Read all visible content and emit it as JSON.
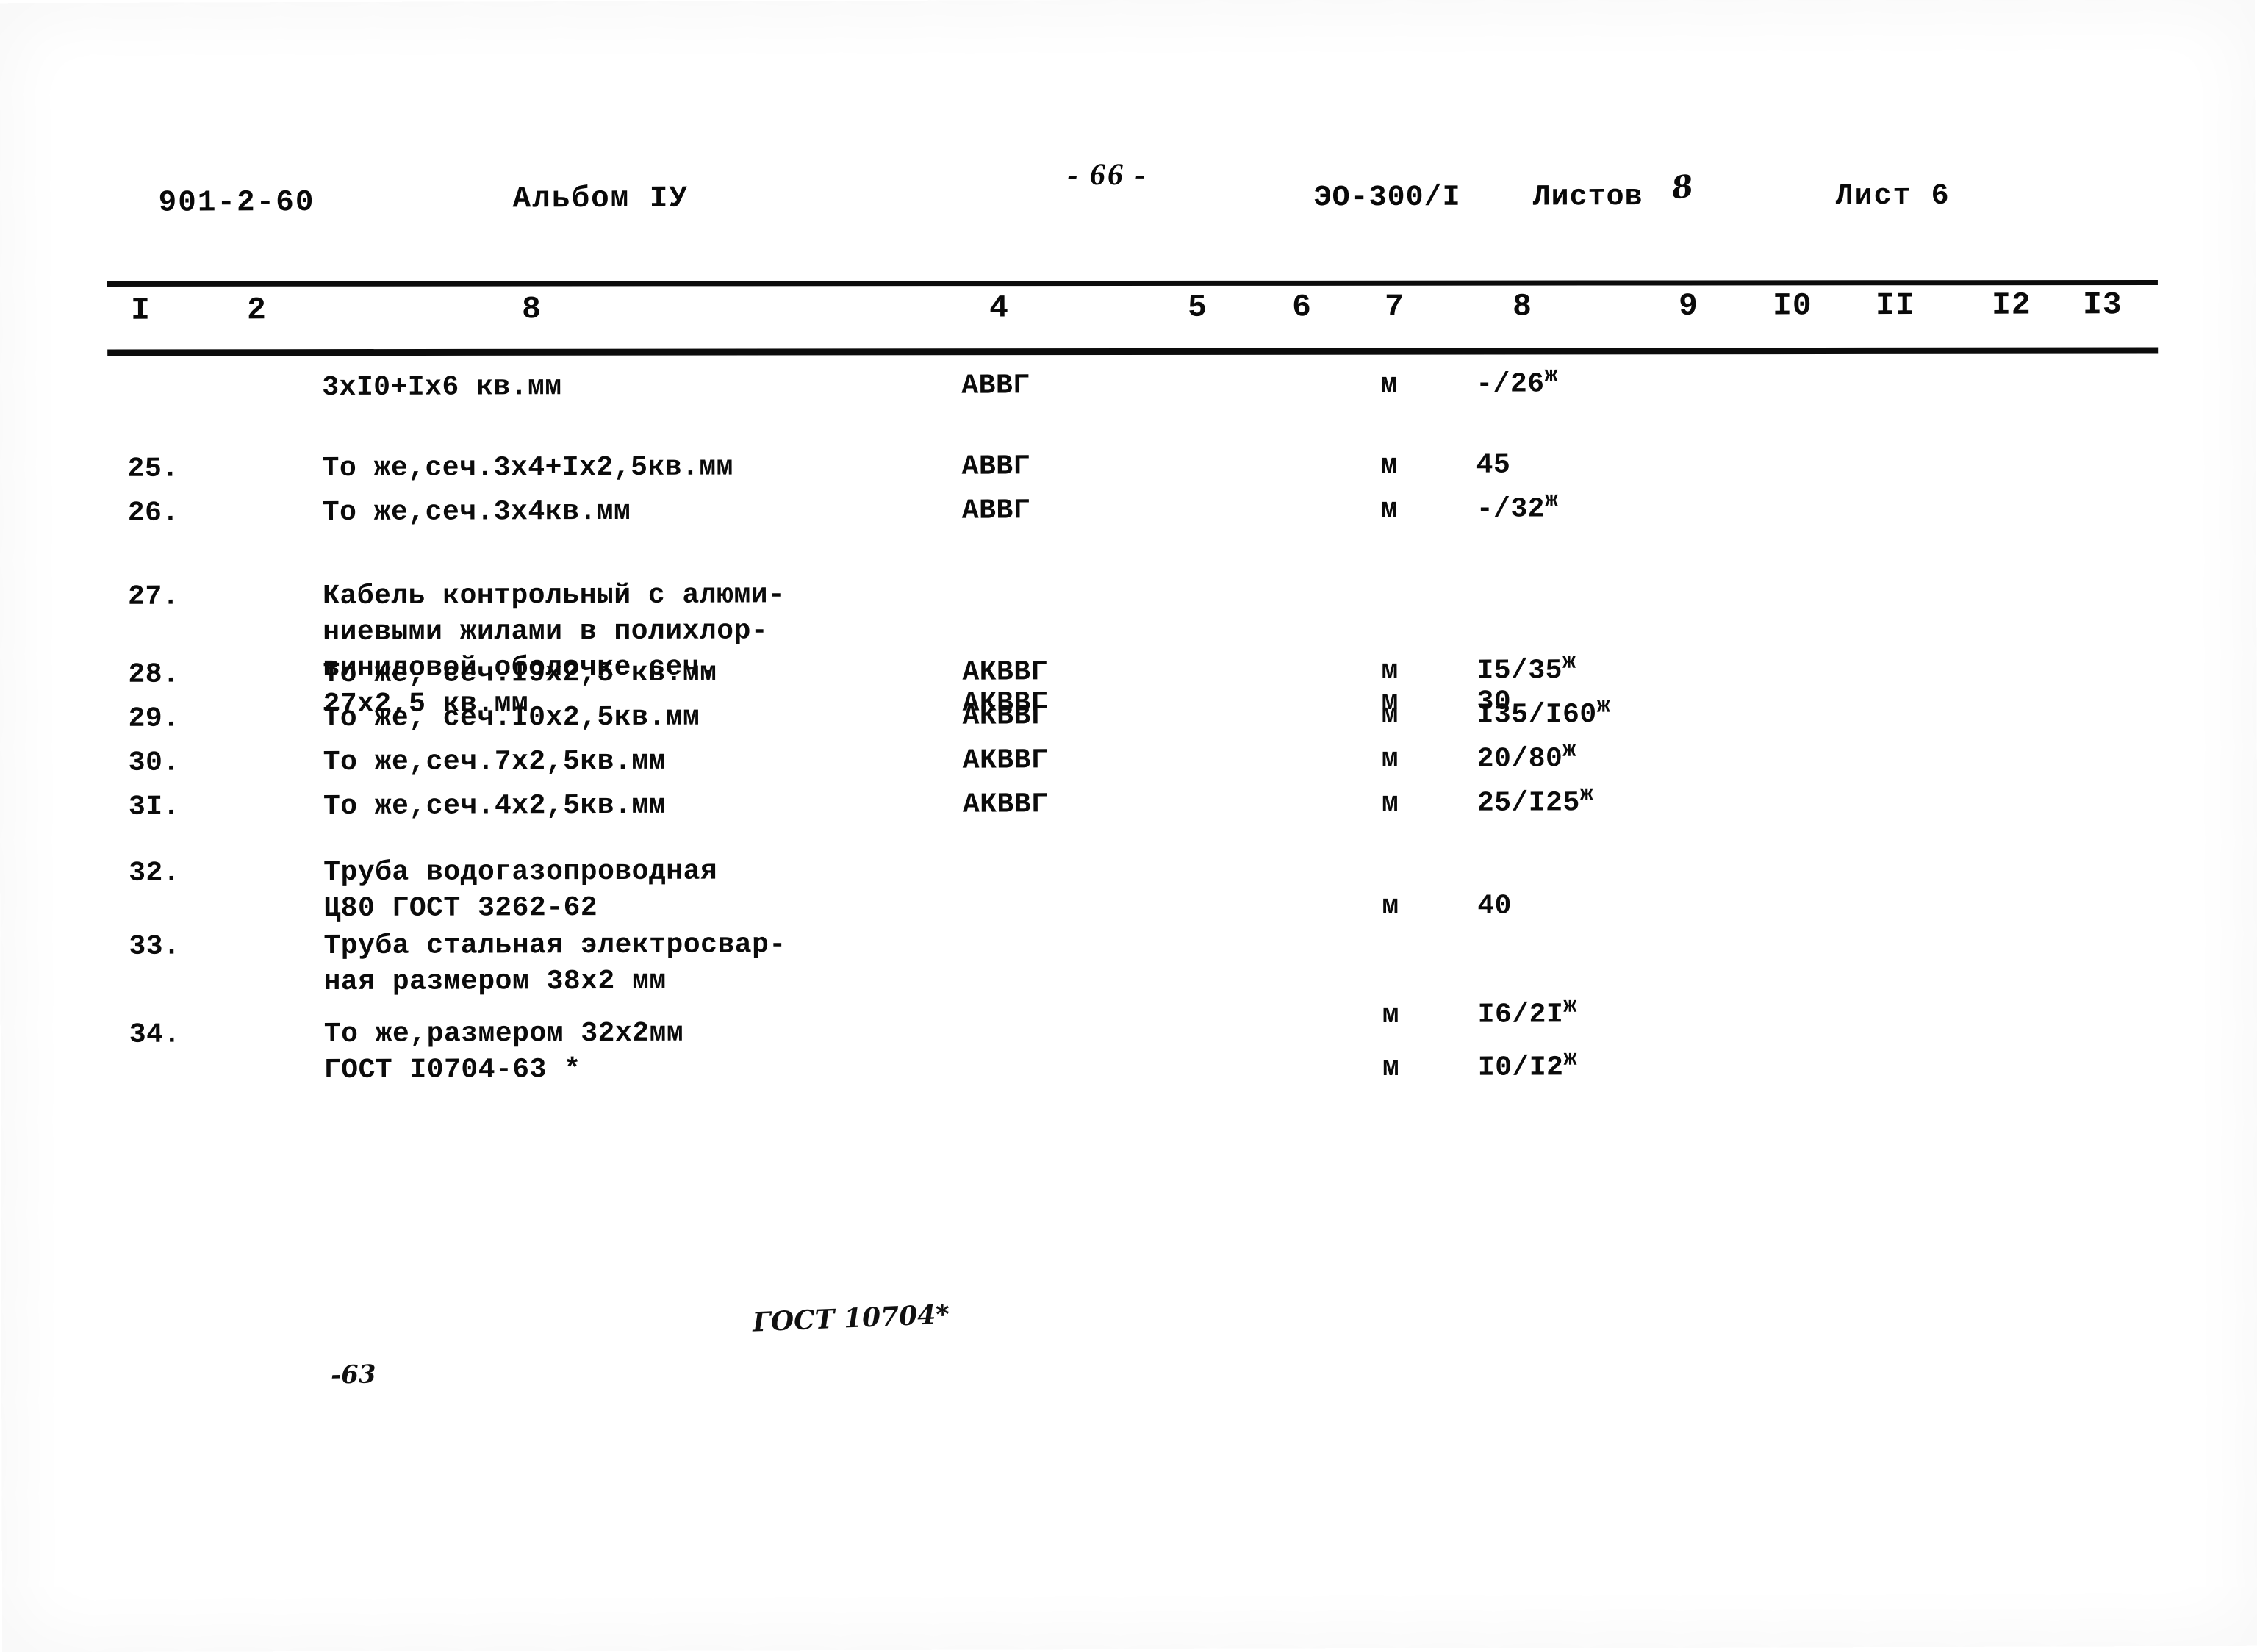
{
  "header": {
    "doc_code": "901-2-60",
    "album": "Альбом IУ",
    "page_number": "- 66 -",
    "sheet_id": "ЭО-300/I",
    "listov_label": "Листов",
    "listov_value": "8",
    "list_label": "Лист 6"
  },
  "table": {
    "column_numbers": [
      "I",
      "2",
      "8",
      "4",
      "5",
      "6",
      "7",
      "8",
      "9",
      "I0",
      "II",
      "I2",
      "I3"
    ],
    "rows": [
      {
        "num": "",
        "desc": [
          "3хI0+Iх6 кв.мм"
        ],
        "brand": "АВВГ",
        "unit": "м",
        "qty": "-/26",
        "qty_sup": "ж"
      },
      {
        "num": "25.",
        "desc": [
          "То же,сеч.3х4+Iх2,5кв.мм"
        ],
        "brand": "АВВГ",
        "unit": "м",
        "qty": "45",
        "qty_sup": ""
      },
      {
        "num": "26.",
        "desc": [
          "То же,сеч.3х4кв.мм"
        ],
        "brand": "АВВГ",
        "unit": "м",
        "qty": "-/32",
        "qty_sup": "ж"
      },
      {
        "num": "27.",
        "desc": [
          "Кабель контрольный с алюми-",
          "ниевыми жилами в полихлор-",
          "виниловой оболочке сеч.",
          "27х2,5 кв.мм"
        ],
        "brand": "АКВВГ",
        "unit": "м",
        "qty": "30",
        "qty_sup": ""
      },
      {
        "num": "28.",
        "desc": [
          "То же, сеч.I9х2,5 кв.мм"
        ],
        "brand": "АКВВГ",
        "unit": "м",
        "qty": "I5/35",
        "qty_sup": "ж"
      },
      {
        "num": "29.",
        "desc": [
          "То же, сеч.I0х2,5кв.мм"
        ],
        "brand": "АКВВГ",
        "unit": "м",
        "qty": "I35/I60",
        "qty_sup": "ж"
      },
      {
        "num": "30.",
        "desc": [
          "То же,сеч.7х2,5кв.мм"
        ],
        "brand": "АКВВГ",
        "unit": "м",
        "qty": "20/80",
        "qty_sup": "ж"
      },
      {
        "num": "3I.",
        "desc": [
          "То же,сеч.4х2,5кв.мм"
        ],
        "brand": "АКВВГ",
        "unit": "м",
        "qty": "25/I25",
        "qty_sup": "ж"
      },
      {
        "num": "32.",
        "desc": [
          "Труба водогазопроводная",
          "Ц80 ГОСТ 3262-62"
        ],
        "brand": "",
        "unit": "м",
        "qty": "40",
        "qty_sup": ""
      },
      {
        "num": "33.",
        "desc": [
          "Труба стальная электросвар-",
          "ная размером 38х2 мм"
        ],
        "brand": "",
        "unit": "м",
        "qty": "I6/2I",
        "qty_sup": "ж"
      },
      {
        "num": "34.",
        "desc": [
          "То же,размером 32х2мм",
          "ГОСТ I0704-63 *"
        ],
        "brand": "",
        "unit": "м",
        "qty": "I0/I2",
        "qty_sup": "ж"
      }
    ]
  },
  "annotations": {
    "handwritten_gost": "ГОСТ 10704*",
    "handwritten_year": "-63"
  },
  "colors": {
    "ink": "#0b0b0b",
    "paper": "#ffffff"
  }
}
